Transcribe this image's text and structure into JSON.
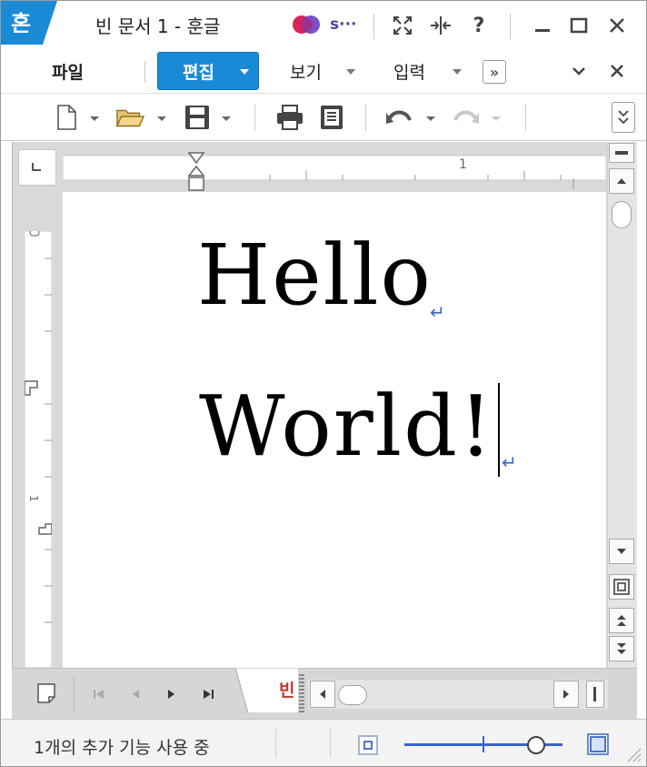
{
  "titlebar": {
    "app_logo_char": "혼",
    "title": "빈 문서 1 - 훈글",
    "account_label": "s···",
    "buttons": [
      "fullscreen",
      "split-view",
      "help",
      "minimize",
      "maximize",
      "close"
    ],
    "help_label": "?"
  },
  "menubar": {
    "items": [
      {
        "label": "파일",
        "has_dropdown": false
      },
      {
        "label": "편집",
        "has_dropdown": true,
        "active": true
      },
      {
        "label": "보기",
        "has_dropdown": true
      },
      {
        "label": "입력",
        "has_dropdown": true
      }
    ],
    "more_label": "»",
    "accent_color": "#1a8ad6"
  },
  "toolbar": {
    "tools": [
      "new-document",
      "open-folder",
      "save",
      "print",
      "preview",
      "undo",
      "redo"
    ],
    "redo_enabled": false
  },
  "ruler": {
    "horizontal_mark": "1",
    "vertical_mark": "1"
  },
  "document": {
    "lines": [
      "Hello",
      "World!"
    ],
    "paragraph_mark": "↵"
  },
  "tabs": {
    "current_tab_label": "빈"
  },
  "statusbar": {
    "text": "1개의 추가 기능 사용 중"
  }
}
